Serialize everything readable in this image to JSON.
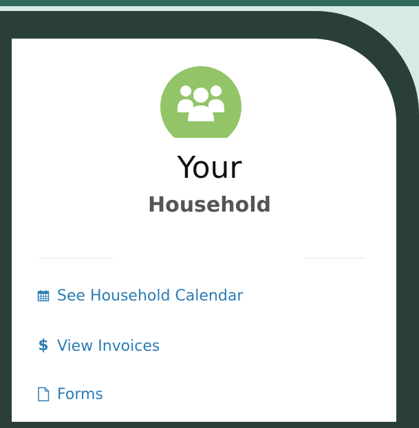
{
  "panel": {
    "avatar_icon": "group-icon",
    "avatar_color": "#93c468",
    "title": "Your",
    "subtitle": "Household"
  },
  "links": [
    {
      "label": "See Household Calendar",
      "icon": "calendar-icon"
    },
    {
      "label": "View Invoices",
      "icon": "dollar-icon"
    },
    {
      "label": "Forms",
      "icon": "file-icon"
    }
  ],
  "colors": {
    "frame": "#2a3f3a",
    "background": "#d7ebe5",
    "top_strip": "#2f6b5e",
    "link": "#2b7cb4"
  }
}
